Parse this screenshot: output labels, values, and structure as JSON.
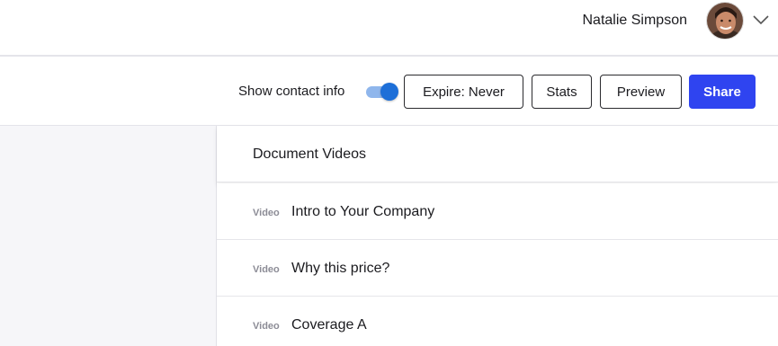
{
  "header": {
    "user_name": "Natalie Simpson"
  },
  "toolbar": {
    "contact_label": "Show contact info",
    "contact_toggle_on": true,
    "expire_label": "Expire: Never",
    "stats_label": "Stats",
    "preview_label": "Preview",
    "share_label": "Share"
  },
  "panel": {
    "title": "Document Videos",
    "videos": [
      {
        "tag": "Video",
        "title": "Intro to Your Company"
      },
      {
        "tag": "Video",
        "title": "Why this price?"
      },
      {
        "tag": "Video",
        "title": "Coverage A"
      }
    ]
  },
  "colors": {
    "accent": "#2f44f0",
    "toggle_on": "#1d6fd8",
    "sidebar_bg": "#f6f6f9"
  }
}
